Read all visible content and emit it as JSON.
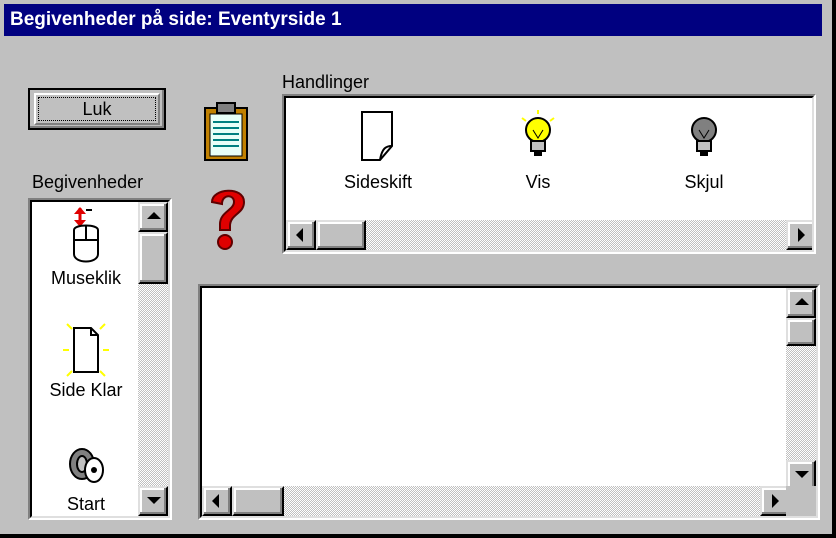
{
  "window": {
    "title": "Begivenheder på side: Eventyrside 1"
  },
  "close_button": {
    "label": "Luk"
  },
  "events": {
    "label": "Begivenheder",
    "items": [
      {
        "label": "Museklik",
        "icon": "mouse-click-icon"
      },
      {
        "label": "Side Klar",
        "icon": "page-ready-icon"
      },
      {
        "label": "Start",
        "icon": "key-icon"
      }
    ]
  },
  "actions": {
    "label": "Handlinger",
    "items": [
      {
        "label": "Sideskift",
        "icon": "page-turn-icon"
      },
      {
        "label": "Vis",
        "icon": "lightbulb-on-icon"
      },
      {
        "label": "Skjul",
        "icon": "lightbulb-off-icon"
      }
    ]
  },
  "tools": [
    {
      "icon": "clipboard-icon"
    },
    {
      "icon": "help-question-icon"
    }
  ],
  "colors": {
    "title_bar": "#000080",
    "dialog_bg": "#c0c0c0",
    "bulb_on": "#ffff00",
    "help_red": "#e00000"
  }
}
